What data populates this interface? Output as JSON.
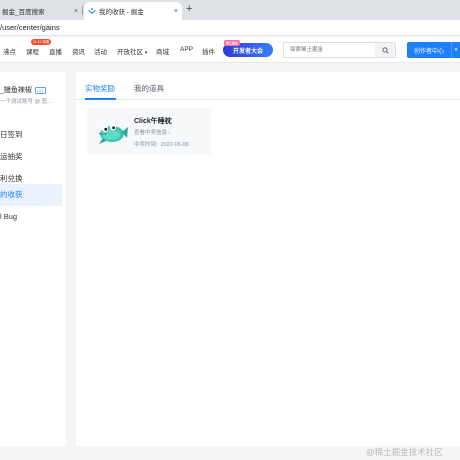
{
  "browser": {
    "tabs": [
      {
        "title": "掘金_百度搜索",
        "active": false
      },
      {
        "title": "我的收获 - 掘金",
        "active": true
      }
    ],
    "close_glyph": "×",
    "new_tab_glyph": "+",
    "url": "/user/center/gains"
  },
  "header": {
    "nav": [
      "沸点",
      "课程",
      "直播",
      "资讯",
      "活动",
      "开放社区",
      "商城",
      "APP",
      "插件"
    ],
    "hot_badge": "11.11 特惠",
    "open_community_caret": "▾",
    "banner": {
      "text": "开发者大会",
      "ribbon": "稀土掘金"
    },
    "search_placeholder": "探索稀土掘金",
    "creator_button": "创作者中心",
    "creator_more": "▾"
  },
  "sidebar": {
    "user_name": "_鳗鱼辣椒",
    "level_badge": "LV1",
    "description": "一个测试账号 @ 恶...",
    "items": [
      {
        "label": "日签到",
        "active": false
      },
      {
        "label": "运抽奖",
        "active": false
      },
      {
        "label": "利兑换",
        "active": false
      },
      {
        "label": "的收获",
        "active": true
      },
      {
        "label": "l Bug",
        "active": false
      }
    ]
  },
  "content": {
    "tabs": [
      {
        "label": "实物奖励",
        "active": true
      },
      {
        "label": "我的道具",
        "active": false
      }
    ],
    "prize": {
      "title": "Click午睡枕",
      "link": "查看中奖信息 ›",
      "date_label": "中奖时间:",
      "date": "2022-06-09",
      "image": "fish-pillow-illustration"
    }
  },
  "watermark": "@稀土掘金技术社区",
  "colors": {
    "accent": "#1e80ff",
    "active_bg": "#eaf2ff",
    "hot": "#ee502f"
  }
}
